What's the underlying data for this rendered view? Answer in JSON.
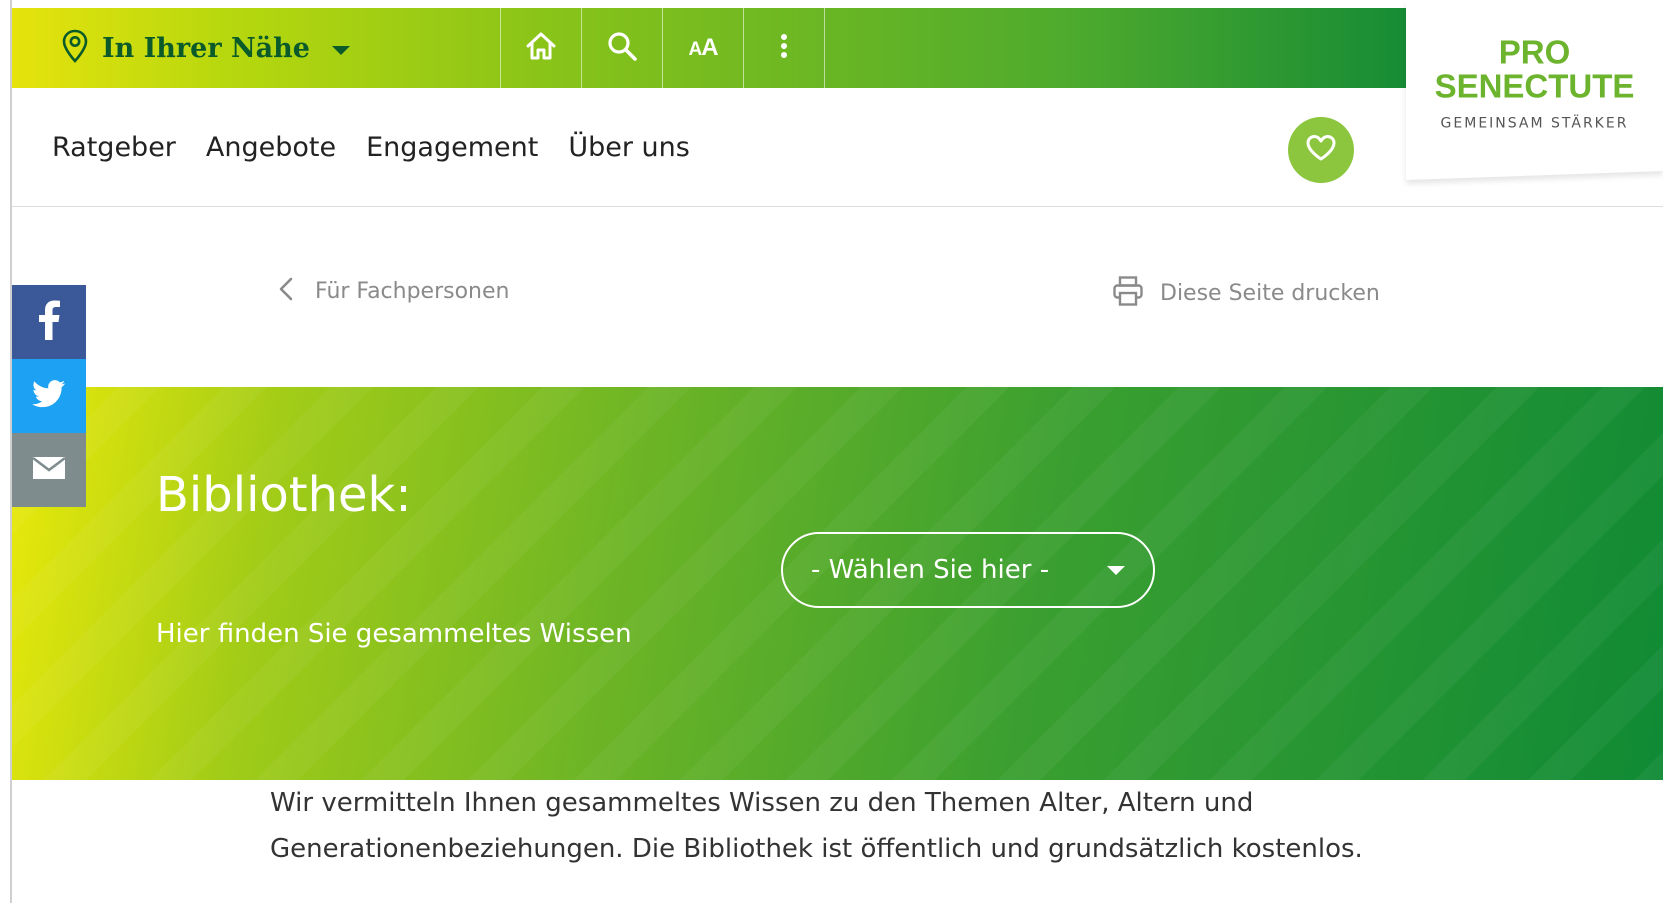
{
  "topbar": {
    "location_label": "In Ihrer Nähe",
    "tools": [
      {
        "name": "home-icon"
      },
      {
        "name": "search-icon"
      },
      {
        "name": "font-size-icon",
        "label_small": "A",
        "label_large": "A"
      },
      {
        "name": "more-vertical-icon"
      }
    ]
  },
  "logo": {
    "line1": "PRO",
    "line2": "SENECTUTE",
    "tagline": "GEMEINSAM STÄRKER",
    "color": "#6cb32e"
  },
  "nav": {
    "items": [
      "Ratgeber",
      "Angebote",
      "Engagement",
      "Über uns"
    ]
  },
  "favorites": {
    "icon": "heart-icon",
    "color": "#8cc63f"
  },
  "breadcrumb": {
    "back_label": "Für Fachpersonen",
    "print_label": "Diese Seite drucken"
  },
  "social": [
    {
      "name": "facebook-icon",
      "color": "#3b5998"
    },
    {
      "name": "twitter-icon",
      "color": "#1da1f2"
    },
    {
      "name": "email-icon",
      "color": "#7f8c8d"
    }
  ],
  "hero": {
    "title": "Bibliothek:",
    "subtitle": "Hier finden Sie gesammeltes Wissen",
    "select_value": "- Wählen Sie hier -"
  },
  "intro": {
    "text": "Wir vermitteln Ihnen gesammeltes Wissen zu den Themen Alter, Altern und Generationenbeziehungen. Die Bibliothek ist öffentlich und grundsätzlich kostenlos."
  }
}
